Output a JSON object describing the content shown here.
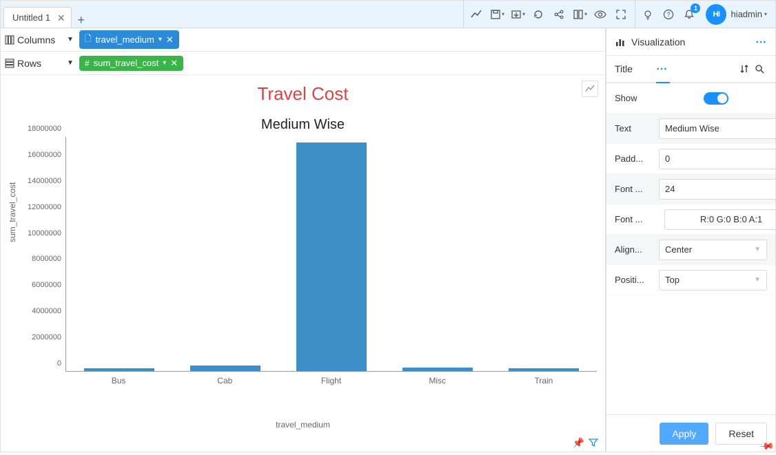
{
  "topbar": {
    "tab_title": "Untitled 1",
    "username": "hiadmin",
    "avatar_initials": "HI",
    "bell_badge": "1"
  },
  "shelves": {
    "columns_label": "Columns",
    "rows_label": "Rows",
    "column_pill": "travel_medium",
    "row_pill": "sum_travel_cost"
  },
  "chart_data": {
    "type": "bar",
    "title": "Travel Cost",
    "subtitle": "Medium Wise",
    "xlabel": "travel_medium",
    "ylabel": "sum_travel_cost",
    "categories": [
      "Bus",
      "Cab",
      "Flight",
      "Misc",
      "Train"
    ],
    "values": [
      200000,
      400000,
      17600000,
      250000,
      200000
    ],
    "ylim": [
      0,
      18000000
    ],
    "yticks": [
      0,
      2000000,
      4000000,
      6000000,
      8000000,
      10000000,
      12000000,
      14000000,
      16000000,
      18000000
    ]
  },
  "panel": {
    "header": "Visualization",
    "section": "Title",
    "show_label": "Show",
    "text_label": "Text",
    "text_value": "Medium Wise",
    "padding_label": "Padd...",
    "padding_value": "0",
    "fontsize_label": "Font ...",
    "fontsize_value": "24",
    "fontcolor_label": "Font ...",
    "fontcolor_value": "R:0 G:0 B:0 A:1",
    "align_label": "Align...",
    "align_value": "Center",
    "position_label": "Positi...",
    "position_value": "Top",
    "apply": "Apply",
    "reset": "Reset"
  }
}
